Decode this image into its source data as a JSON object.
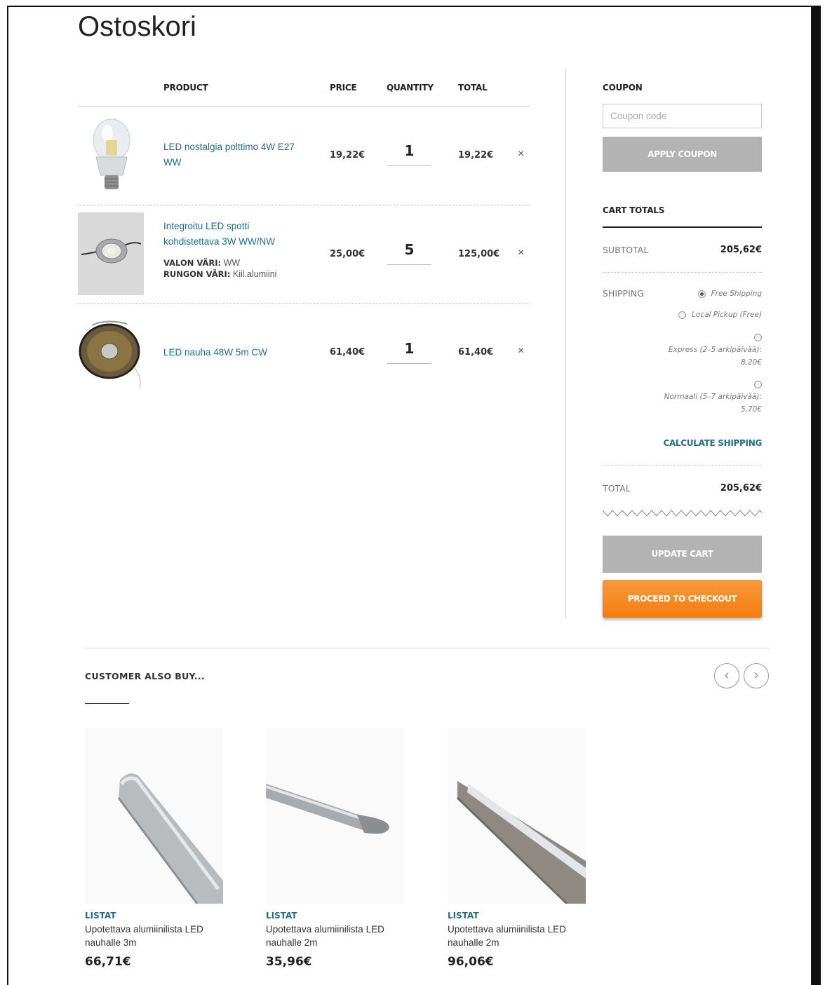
{
  "page": {
    "title": "Ostoskori"
  },
  "cart": {
    "headers": {
      "product": "PRODUCT",
      "price": "PRICE",
      "quantity": "QUANTITY",
      "total": "TOTAL"
    },
    "items": [
      {
        "name": "LED nostalgia polttimo 4W E27 WW",
        "price": "19,22€",
        "quantity": "1",
        "total": "19,22€",
        "remove": "×",
        "image": "led-bulb"
      },
      {
        "name": "Integroitu LED spotti kohdistettava 3W WW/NW",
        "price": "25,00€",
        "quantity": "5",
        "total": "125,00€",
        "remove": "×",
        "image": "led-spot",
        "meta": [
          {
            "label": "VALON VÄRI:",
            "value": "WW"
          },
          {
            "label": "RUNGON VÄRI:",
            "value": "Kiil.alumiini"
          }
        ]
      },
      {
        "name": "LED nauha 48W 5m CW",
        "price": "61,40€",
        "quantity": "1",
        "total": "61,40€",
        "remove": "×",
        "image": "led-strip-reel"
      }
    ]
  },
  "coupon": {
    "heading": "COUPON",
    "placeholder": "Coupon code",
    "apply_label": "APPLY COUPON"
  },
  "totals": {
    "heading": "CART TOTALS",
    "subtotal_label": "SUBTOTAL",
    "subtotal_value": "205,62€",
    "shipping_label": "SHIPPING",
    "shipping_options": [
      {
        "label": "Free Shipping",
        "selected": true
      },
      {
        "label": "Local Pickup (Free)",
        "selected": false
      },
      {
        "label": "Express (2–5 arkipäivää):",
        "price": "8,20€",
        "selected": false
      },
      {
        "label": "Normaali (5–7 arkipäivää):",
        "price": "5,70€",
        "selected": false
      }
    ],
    "calculate_label": "CALCULATE SHIPPING",
    "total_label": "TOTAL",
    "total_value": "205,62€",
    "update_label": "UPDATE CART",
    "checkout_label": "PROCEED TO CHECKOUT"
  },
  "also_buy": {
    "title": "CUSTOMER ALSO BUY...",
    "prev": "‹",
    "next": "›",
    "products": [
      {
        "category": "LISTAT",
        "name": "Upotettava alumiinilista LED nauhalle 3m",
        "price": "66,71€"
      },
      {
        "category": "LISTAT",
        "name": "Upotettava alumiinilista LED nauhalle 2m",
        "price": "35,96€"
      },
      {
        "category": "LISTAT",
        "name": "Upotettava alumiinilista LED nauhalle 2m",
        "price": "96,06€"
      }
    ]
  },
  "colors": {
    "link": "#1f6f8b",
    "button_grey": "#b3b3b3",
    "checkout_orange": "#f57c10"
  }
}
